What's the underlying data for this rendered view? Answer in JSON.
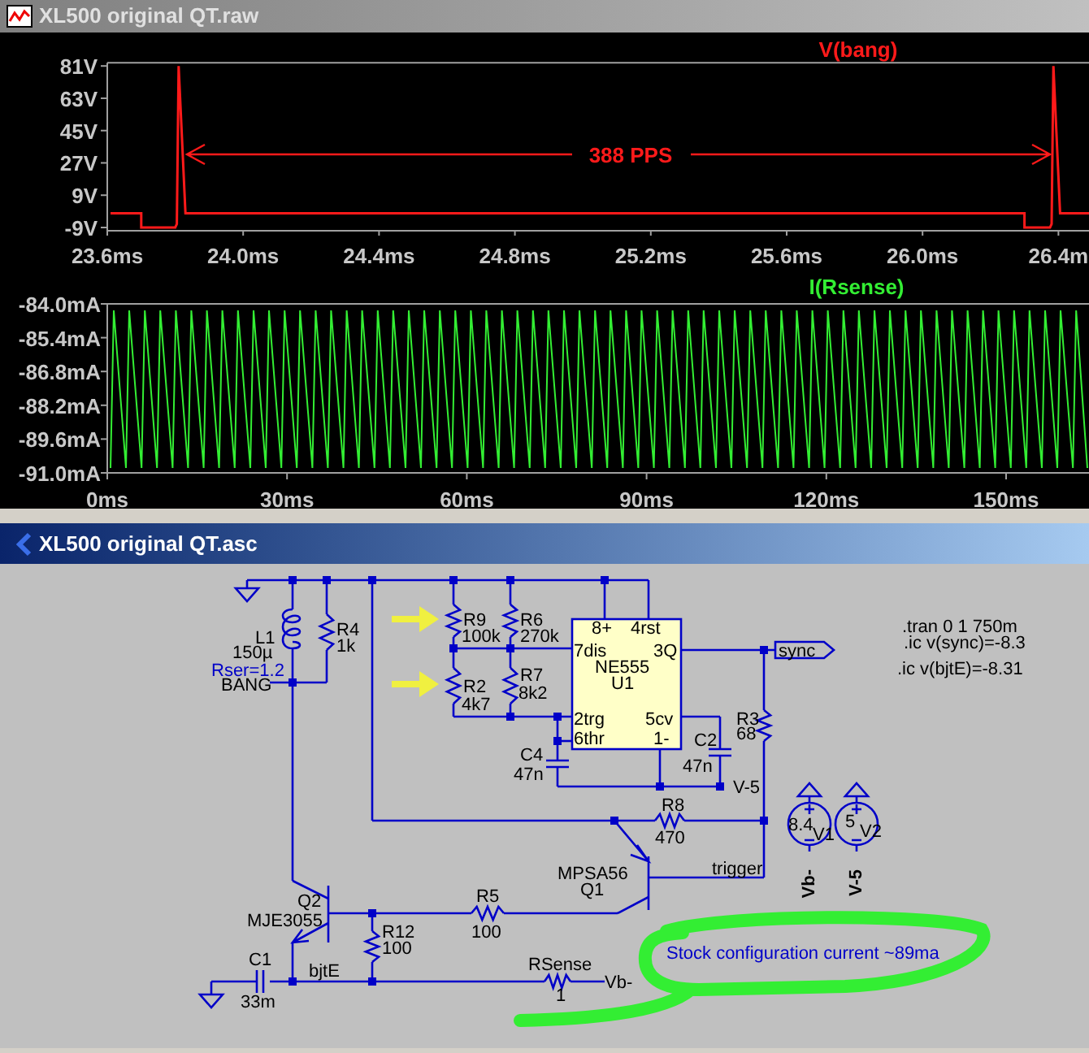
{
  "plot_window": {
    "title": "XL500 original QT.raw",
    "voltage_plot": {
      "chart_data": {
        "type": "line",
        "xlim": [
          23.6,
          26.49
        ],
        "ylim": [
          -9,
          81
        ],
        "xticks": [
          {
            "value": 23.6,
            "label": "23.6ms"
          },
          {
            "value": 24.0,
            "label": "24.0ms"
          },
          {
            "value": 24.4,
            "label": "24.4ms"
          },
          {
            "value": 24.8,
            "label": "24.8ms"
          },
          {
            "value": 25.2,
            "label": "25.2ms"
          },
          {
            "value": 25.6,
            "label": "25.6ms"
          },
          {
            "value": 26.0,
            "label": "26.0ms"
          },
          {
            "value": 26.4,
            "label": "26.4m"
          }
        ],
        "yticks": [
          {
            "value": 81,
            "label": "81V"
          },
          {
            "value": 63,
            "label": "63V"
          },
          {
            "value": 45,
            "label": "45V"
          },
          {
            "value": 27,
            "label": "27V"
          },
          {
            "value": 9,
            "label": "9V"
          },
          {
            "value": -9,
            "label": "-9V"
          }
        ],
        "x": [
          23.6,
          23.7,
          23.7,
          23.8,
          23.805,
          23.81,
          23.83,
          26.3,
          26.3,
          26.375,
          26.38,
          26.385,
          26.405,
          26.49
        ],
        "series": [
          {
            "name": "V(bang)",
            "color": "#ff1a1a",
            "values": [
              -1,
              -1,
              -9,
              -9,
              -7,
              81,
              -1,
              -1,
              -9,
              -9,
              -7,
              81,
              -1,
              -1
            ]
          }
        ],
        "annotations": [
          {
            "text": "388 PPS"
          }
        ]
      }
    },
    "current_plot": {
      "trace_label": "I(Rsense)",
      "y_tick_labels": [
        "-84.0mA",
        "-85.4mA",
        "-86.8mA",
        "-88.2mA",
        "-89.6mA",
        "-91.0mA"
      ],
      "x_tick_labels": [
        "0ms",
        "30ms",
        "60ms",
        "90ms",
        "120ms",
        "150ms"
      ]
    }
  },
  "schematic_window": {
    "title": "XL500 original QT.asc",
    "labels": [
      {
        "text": "L1",
        "kind": "text"
      },
      {
        "text": "150µ",
        "kind": "text"
      },
      {
        "text": "Rser=1.2",
        "kind": "spice"
      },
      {
        "text": "BANG",
        "kind": "text"
      },
      {
        "text": "R4",
        "kind": "text"
      },
      {
        "text": "1k",
        "kind": "text"
      },
      {
        "text": "R9",
        "kind": "text"
      },
      {
        "text": "100k",
        "kind": "text"
      },
      {
        "text": "R6",
        "kind": "text"
      },
      {
        "text": "270k",
        "kind": "text"
      },
      {
        "text": "R7",
        "kind": "text"
      },
      {
        "text": "8k2",
        "kind": "text"
      },
      {
        "text": "R2",
        "kind": "text"
      },
      {
        "text": "4k7",
        "kind": "text"
      },
      {
        "text": "8+",
        "kind": "text"
      },
      {
        "text": "4rst",
        "kind": "text"
      },
      {
        "text": "7dis",
        "kind": "text"
      },
      {
        "text": "3Q",
        "kind": "text"
      },
      {
        "text": "NE555",
        "kind": "text"
      },
      {
        "text": "U1",
        "kind": "text"
      },
      {
        "text": "2trg",
        "kind": "text"
      },
      {
        "text": "5cv",
        "kind": "text"
      },
      {
        "text": "6thr",
        "kind": "text"
      },
      {
        "text": "1-",
        "kind": "text"
      },
      {
        "text": "sync",
        "kind": "text"
      },
      {
        "text": ".tran 0 1 750m",
        "kind": "text"
      },
      {
        "text": ".ic v(sync)=-8.3",
        "kind": "text"
      },
      {
        "text": ".ic v(bjtE)=-8.31",
        "kind": "text"
      },
      {
        "text": "R3",
        "kind": "text"
      },
      {
        "text": "68",
        "kind": "text"
      },
      {
        "text": "C4",
        "kind": "text"
      },
      {
        "text": "47n",
        "kind": "text"
      },
      {
        "text": "C2",
        "kind": "text"
      },
      {
        "text": "47n",
        "kind": "text"
      },
      {
        "text": "V-5",
        "kind": "text"
      },
      {
        "text": "R8",
        "kind": "text"
      },
      {
        "text": "470",
        "kind": "text"
      },
      {
        "text": "8.4",
        "kind": "text"
      },
      {
        "text": "V1",
        "kind": "text"
      },
      {
        "text": "5",
        "kind": "text"
      },
      {
        "text": "V2",
        "kind": "text"
      },
      {
        "text": "Vb-",
        "kind": "vertical"
      },
      {
        "text": "V-5",
        "kind": "vertical"
      },
      {
        "text": "MPSA56",
        "kind": "text"
      },
      {
        "text": "Q1",
        "kind": "text"
      },
      {
        "text": "trigger",
        "kind": "text"
      },
      {
        "text": "Q2",
        "kind": "text"
      },
      {
        "text": "MJE3055",
        "kind": "text"
      },
      {
        "text": "R5",
        "kind": "text"
      },
      {
        "text": "100",
        "kind": "text"
      },
      {
        "text": "R12",
        "kind": "text"
      },
      {
        "text": "100",
        "kind": "text"
      },
      {
        "text": "C1",
        "kind": "text"
      },
      {
        "text": "bjtE",
        "kind": "text"
      },
      {
        "text": "RSense",
        "kind": "text"
      },
      {
        "text": "Vb-",
        "kind": "text"
      },
      {
        "text": "33m",
        "kind": "text"
      },
      {
        "text": "1",
        "kind": "text"
      },
      {
        "text": "Stock configuration current ~89ma",
        "kind": "spice"
      }
    ]
  }
}
